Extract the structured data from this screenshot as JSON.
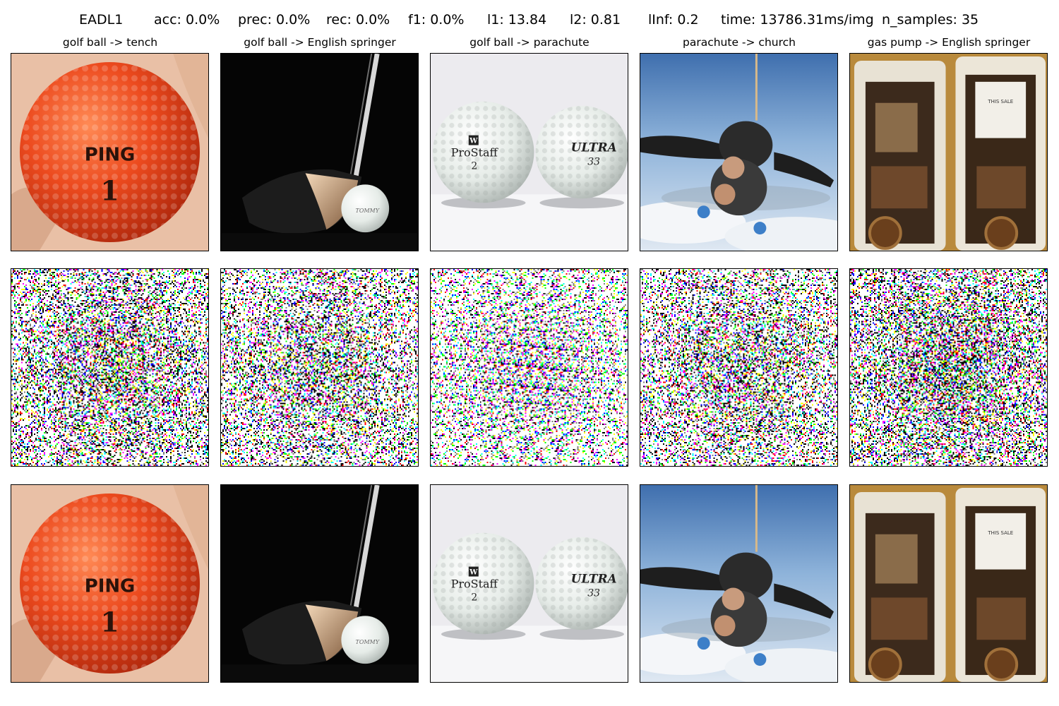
{
  "header": {
    "method": "EADL1",
    "acc": "acc: 0.0%",
    "prec": "prec: 0.0%",
    "rec": "rec: 0.0%",
    "f1": "f1: 0.0%",
    "l1": "l1: 13.84",
    "l2": "l2: 0.81",
    "linf": "lInf: 0.2",
    "time": "time: 13786.31ms/img",
    "n_samples": "n_samples: 35"
  },
  "columns": [
    {
      "title": "golf ball -> tench"
    },
    {
      "title": "golf ball -> English springer"
    },
    {
      "title": "golf ball -> parachute"
    },
    {
      "title": "parachute -> church"
    },
    {
      "title": "gas pump -> English springer"
    }
  ],
  "image_text": {
    "ping_brand": "PING",
    "ping_number": "1",
    "driver_ball_text": "TOMMY",
    "prostaff_logo": "W",
    "prostaff_brand": "ProStaff",
    "prostaff_number": "2",
    "ultra_brand": "ULTRA",
    "ultra_number": "33",
    "gas_sign": "THIS SALE"
  },
  "colors": {
    "orange_ball": "#e8451c",
    "driver_bg": "#050505",
    "golf_white": "#eef2ef",
    "sky_blue": "#5f8fc5",
    "rust": "#8a5a2a"
  }
}
